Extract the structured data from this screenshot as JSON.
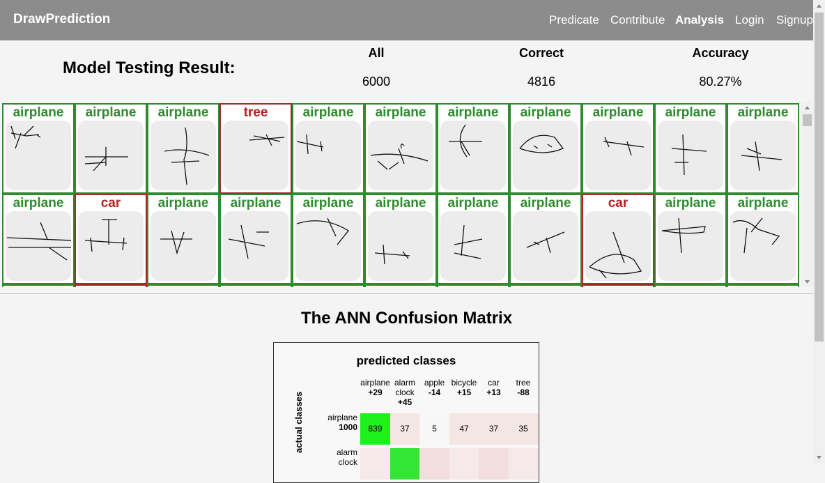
{
  "navbar": {
    "brand": "DrawPrediction",
    "links": [
      "Predicate",
      "Contribute",
      "Analysis",
      "Login",
      "Signup"
    ],
    "active": "Analysis",
    "bg_color": "#8c8c8c"
  },
  "stats": {
    "title": "Model Testing Result:",
    "headers": [
      "All",
      "Correct",
      "Accuracy"
    ],
    "values": [
      "6000",
      "4816",
      "80.27%"
    ]
  },
  "drawings": {
    "row1": [
      "airplane",
      "airplane",
      "airplane",
      "tree",
      "airplane",
      "airplane",
      "airplane",
      "airplane",
      "airplane",
      "airplane",
      "airplane"
    ],
    "row2": [
      "airplane",
      "car",
      "airplane",
      "airplane",
      "airplane",
      "airplane",
      "airplane",
      "airplane",
      "car",
      "airplane",
      "airplane"
    ],
    "correct_color": "#2e8b2e",
    "wrong_color": "#b22222"
  },
  "confusion": {
    "title": "The ANN Confusion Matrix",
    "pred_title": "predicted classes",
    "actual_title": "actual classes",
    "columns": [
      {
        "name": "airplane",
        "delta": "+29"
      },
      {
        "name": "alarm clock",
        "delta": "+45"
      },
      {
        "name": "apple",
        "delta": "-14"
      },
      {
        "name": "bicycle",
        "delta": "+15"
      },
      {
        "name": "car",
        "delta": "+13"
      },
      {
        "name": "tree",
        "delta": "-88"
      }
    ],
    "rows": [
      {
        "name": "airplane",
        "total": "1000",
        "values": [
          "839",
          "37",
          "5",
          "47",
          "37",
          "35"
        ]
      },
      {
        "name": "alarm clock",
        "total": "",
        "values": [
          "",
          "",
          "",
          "",
          "",
          ""
        ]
      }
    ]
  }
}
